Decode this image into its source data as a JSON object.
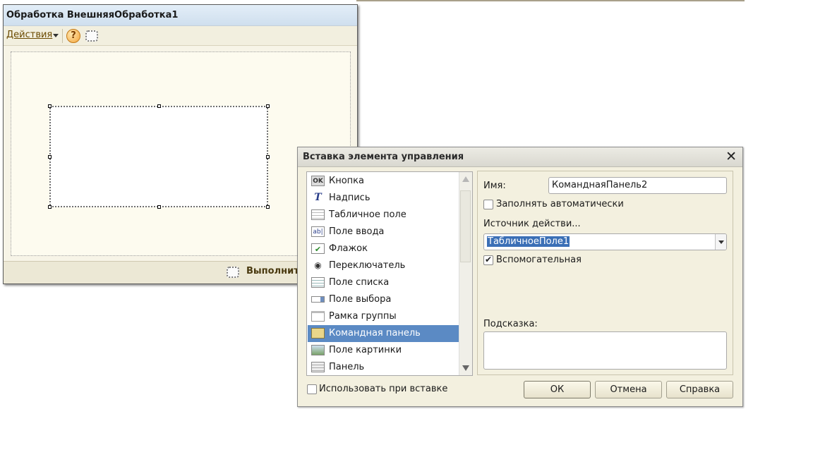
{
  "form_window": {
    "title": "Обработка  ВнешняяОбработка1",
    "toolbar": {
      "actions_label": "Действия",
      "help_glyph": "?",
      "icons": [
        "chevron-down-icon",
        "help-icon",
        "dotted-frame-icon"
      ]
    },
    "footer": {
      "run_label": "Выполнить"
    }
  },
  "dialog": {
    "title": "Вставка элемента управления",
    "close_glyph": "✕",
    "controls": [
      {
        "label": "Кнопка",
        "icon": "ok-button-icon",
        "icon_glyph": "OK"
      },
      {
        "label": "Надпись",
        "icon": "label-t-icon",
        "icon_glyph": "T"
      },
      {
        "label": "Табличное поле",
        "icon": "table-field-icon",
        "icon_glyph": ""
      },
      {
        "label": "Поле ввода",
        "icon": "input-field-icon",
        "icon_glyph": "ab|"
      },
      {
        "label": "Флажок",
        "icon": "checkbox-icon",
        "icon_glyph": "✔"
      },
      {
        "label": "Переключатель",
        "icon": "radio-icon",
        "icon_glyph": "◉"
      },
      {
        "label": "Поле списка",
        "icon": "list-field-icon",
        "icon_glyph": ""
      },
      {
        "label": "Поле выбора",
        "icon": "select-field-icon",
        "icon_glyph": ""
      },
      {
        "label": "Рамка группы",
        "icon": "group-frame-icon",
        "icon_glyph": ""
      },
      {
        "label": "Командная панель",
        "icon": "command-panel-icon",
        "icon_glyph": ""
      },
      {
        "label": "Поле картинки",
        "icon": "picture-field-icon",
        "icon_glyph": ""
      },
      {
        "label": "Панель",
        "icon": "panel-icon",
        "icon_glyph": ""
      }
    ],
    "selected_index": 9,
    "props": {
      "name_label": "Имя:",
      "name_value": "КоманднаяПанель2",
      "autofill_label": "Заполнять автоматически",
      "autofill_checked": false,
      "source_label": "Источник действи...",
      "source_value": "ТабличноеПоле1",
      "auxiliary_label": "Вспомогательная",
      "auxiliary_checked": true,
      "hint_label": "Подсказка:",
      "hint_value": ""
    },
    "use_on_insert_label": "Использовать при вставке",
    "use_on_insert_checked": false,
    "buttons": {
      "ok": "ОК",
      "cancel": "Отмена",
      "help": "Справка"
    }
  },
  "colors": {
    "selection": "#5b8ac4",
    "form_bg": "#f7f4e7",
    "dialog_bg": "#f3f0df"
  }
}
